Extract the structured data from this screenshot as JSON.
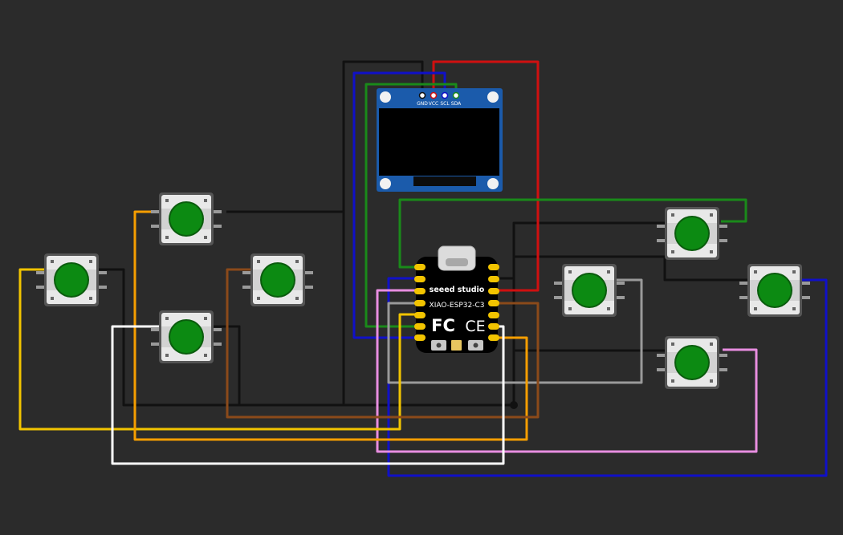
{
  "oled": {
    "pins": [
      "GND",
      "VCC",
      "SCL",
      "SDA"
    ]
  },
  "board": {
    "brand": "seeed studio",
    "model": "XIAO-ESP32-C3",
    "cert_fcc": "FC",
    "cert_ce": "CE"
  },
  "buttons": [
    {
      "id": "btn-1",
      "color": "#0c8a12"
    },
    {
      "id": "btn-2",
      "color": "#0c8a12"
    },
    {
      "id": "btn-3",
      "color": "#0c8a12"
    },
    {
      "id": "btn-4",
      "color": "#0c8a12"
    },
    {
      "id": "btn-5",
      "color": "#0c8a12"
    },
    {
      "id": "btn-6",
      "color": "#0c8a12"
    },
    {
      "id": "btn-7",
      "color": "#0c8a12"
    },
    {
      "id": "btn-8",
      "color": "#0c8a12"
    },
    {
      "id": "btn-9",
      "color": "#0c8a12"
    }
  ],
  "wire_colors": {
    "black": "#111111",
    "red": "#d01010",
    "blue": "#1010c8",
    "green": "#1a8a1a",
    "yellow": "#f2c400",
    "orange": "#f59e00",
    "brown": "#8b4a1a",
    "white": "#ffffff",
    "gray": "#9a9a9a",
    "pink": "#e88ee0"
  }
}
